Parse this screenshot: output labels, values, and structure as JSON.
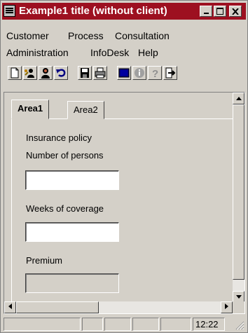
{
  "window": {
    "title": "Example1 title  (without client)"
  },
  "menus": [
    [
      "Customer",
      "Process",
      "Consultation"
    ],
    [
      "Administration",
      "InfoDesk",
      "Help"
    ]
  ],
  "toolbar": {
    "buttons": [
      "new-document-icon",
      "customer-search-icon",
      "person-icon",
      "undo-icon",
      "save-icon",
      "print-icon",
      "window-icon",
      "info-icon",
      "help-icon",
      "exit-icon"
    ]
  },
  "tabs": [
    {
      "label": "Area1",
      "active": true
    },
    {
      "label": "Area2",
      "active": false
    }
  ],
  "form": {
    "insurance_policy": "Insurance policy",
    "number_of_persons": "Number of persons",
    "number_of_persons_value": "",
    "weeks_of_coverage": "Weeks of coverage",
    "weeks_of_coverage_value": "",
    "premium": "Premium",
    "premium_value": ""
  },
  "status": {
    "time": "12:22"
  },
  "colors": {
    "titlebar": "#9d1020",
    "face": "#d4d0c8"
  }
}
